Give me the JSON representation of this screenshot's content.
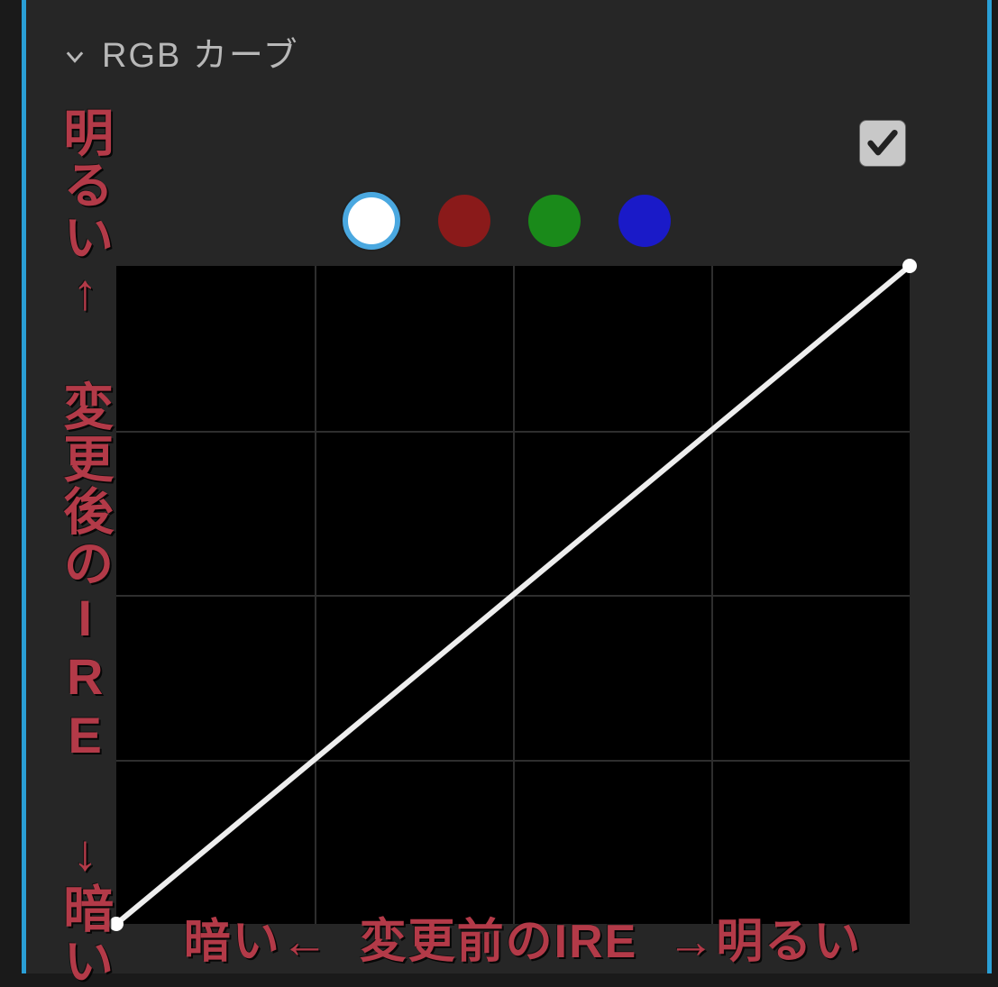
{
  "section": {
    "title": "RGB カーブ",
    "enable_checked": true
  },
  "channels": {
    "items": [
      {
        "id": "luma",
        "color": "#ffffff",
        "selected": true
      },
      {
        "id": "red",
        "color": "#8a1a1a",
        "selected": false
      },
      {
        "id": "green",
        "color": "#1a8a1a",
        "selected": false
      },
      {
        "id": "blue",
        "color": "#1a1ac8",
        "selected": false
      }
    ]
  },
  "chart_data": {
    "type": "line",
    "x": [
      0,
      1
    ],
    "y": [
      0,
      1
    ],
    "xlim": [
      0,
      1
    ],
    "ylim": [
      0,
      1
    ],
    "grid_divisions": 4,
    "series": [
      {
        "name": "luma",
        "points": [
          [
            0,
            0
          ],
          [
            1,
            1
          ]
        ],
        "color": "#ffffff"
      }
    ],
    "xlabel": "変更前のIRE",
    "ylabel": "変更後のIRE"
  },
  "annotations": {
    "y_axis_text": "明るい↑ 変更後のIRE ↓暗い",
    "x_axis_text": "暗い←  変更前のIRE  →明るい"
  }
}
